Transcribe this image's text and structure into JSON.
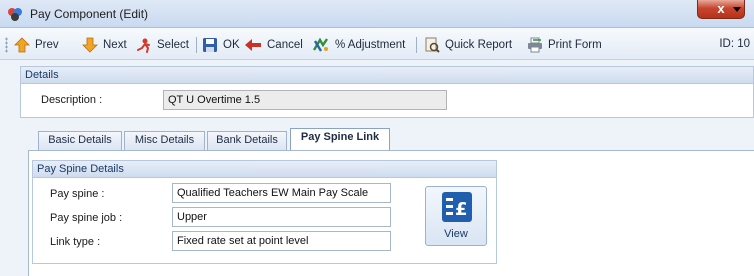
{
  "window": {
    "title": "Pay Component (Edit)",
    "close_glyph": "x"
  },
  "toolbar": {
    "prev_label": "Prev",
    "next_label": "Next",
    "select_label": "Select",
    "ok_label": "OK",
    "cancel_label": "Cancel",
    "adjustment_label": "% Adjustment",
    "quick_report_label": "Quick Report",
    "print_form_label": "Print Form",
    "id_label": "ID: 10"
  },
  "details": {
    "header": "Details",
    "description_label": "Description :",
    "description_value": "QT U Overtime 1.5"
  },
  "tabs": [
    {
      "label": "Basic Details",
      "active": false
    },
    {
      "label": "Misc Details",
      "active": false
    },
    {
      "label": "Bank Details",
      "active": false
    },
    {
      "label": "Pay Spine Link",
      "active": true
    }
  ],
  "pay_spine": {
    "header": "Pay Spine Details",
    "pay_spine_label": "Pay spine :",
    "pay_spine_value": "Qualified Teachers EW Main Pay Scale",
    "pay_spine_job_label": "Pay spine job :",
    "pay_spine_job_value": "Upper",
    "link_type_label": "Link type :",
    "link_type_value": "Fixed rate set at point level",
    "view_button_label": "View"
  },
  "colors": {
    "accent": "#1a3a66",
    "close_button": "#c7462f",
    "prev_arrow": "#e8a21d",
    "cancel_arrow": "#c0392b"
  },
  "icons": [
    "app-icon",
    "prev-arrow-icon",
    "next-arrow-icon",
    "select-icon",
    "ok-save-icon",
    "cancel-arrow-icon",
    "adjustment-icon",
    "quick-report-icon",
    "print-form-icon",
    "pay-scale-icon"
  ]
}
